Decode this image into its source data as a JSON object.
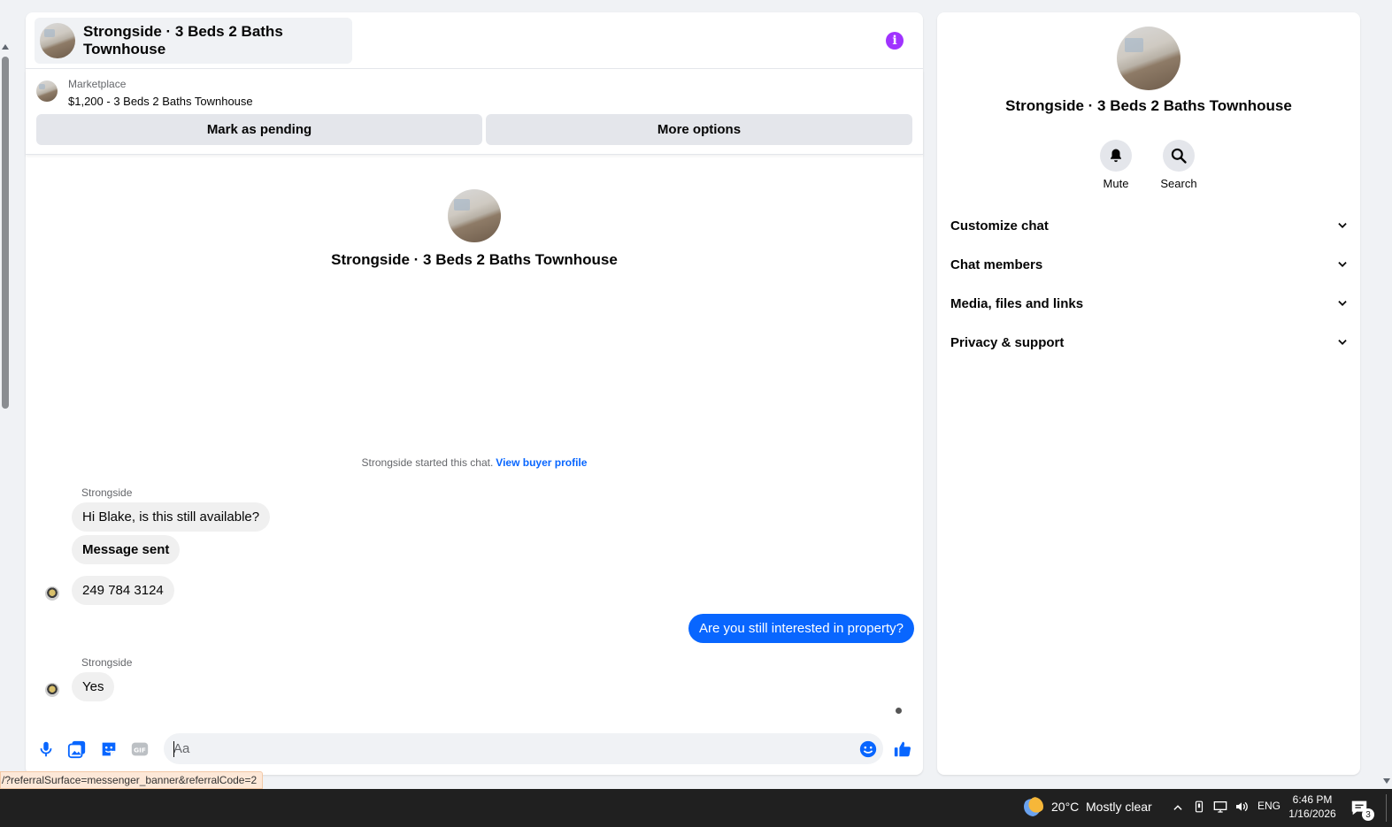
{
  "colors": {
    "accent": "#0866ff",
    "info_icon": "#a033ff",
    "bubble_in": "#f0f0f0"
  },
  "header": {
    "title": "Strongside · 3 Beds 2 Baths Townhouse"
  },
  "listing": {
    "source": "Marketplace",
    "price_title": "$1,200 - 3 Beds 2 Baths Townhouse",
    "mark_pending_label": "Mark as pending",
    "more_options_label": "More options"
  },
  "intro": {
    "name": "Strongside · 3 Beds 2 Baths Townhouse"
  },
  "started": {
    "text": "Strongside started this chat.",
    "link": "View buyer profile"
  },
  "messages": [
    {
      "sender": "Strongside",
      "text": "Hi Blake, is this still available?"
    },
    {
      "text": "Message sent"
    },
    {
      "text": "249 784 3124"
    },
    {
      "text": "Are you still interested in property?"
    },
    {
      "sender": "Strongside",
      "text": "Yes"
    }
  ],
  "composer": {
    "placeholder": "Aa"
  },
  "info_panel": {
    "name": "Strongside · 3 Beds 2 Baths Townhouse",
    "mute_label": "Mute",
    "search_label": "Search",
    "sections": [
      "Customize chat",
      "Chat members",
      "Media, files and links",
      "Privacy & support"
    ]
  },
  "status_url": "/?referralSurface=messenger_banner&referralCode=2",
  "taskbar": {
    "temperature": "20°C",
    "condition": "Mostly clear",
    "language": "ENG",
    "time": "6:46 PM",
    "date": "1/16/2026",
    "notification_count": "3"
  }
}
